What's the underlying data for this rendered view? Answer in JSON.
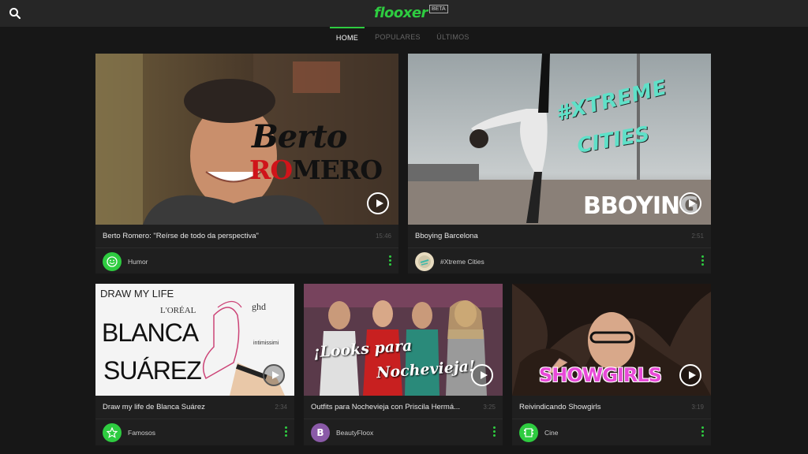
{
  "header": {
    "logo": "flooxer",
    "beta": "BETA",
    "search_icon": "search-icon"
  },
  "nav": {
    "tabs": [
      {
        "label": "HOME",
        "active": true
      },
      {
        "label": "POPULARES",
        "active": false
      },
      {
        "label": "ÚLTIMOS",
        "active": false
      }
    ]
  },
  "colors": {
    "accent": "#2ecc40",
    "background": "#171717",
    "topbar": "#262626"
  },
  "videos": [
    {
      "title": "Berto Romero: \"Reírse de todo da perspectiva\"",
      "duration": "15:46",
      "channel": "Humor",
      "overlay_top": "Berto",
      "overlay_red": "RO",
      "overlay_black": "MERO"
    },
    {
      "title": "Bboying Barcelona",
      "duration": "2:51",
      "channel": "#Xtreme Cities",
      "overlay_top": "#XTREME",
      "overlay_mid": "CITIES",
      "overlay_bottom": "BBOYING"
    },
    {
      "title": "Draw my life de Blanca Suárez",
      "duration": "2:34",
      "channel": "Famosos",
      "overlay_top": "DRAW MY LIFE",
      "overlay_brand1": "L'ORÉAL",
      "overlay_brand2": "ghd",
      "overlay_brand3": "intimissimi",
      "overlay_name1": "BLANCA",
      "overlay_name2": "SUÁREZ"
    },
    {
      "title": "Outfits para Nochevieja con Priscila Hermá...",
      "duration": "3:25",
      "channel": "BeautyFloox",
      "overlay_line1": "¡Looks para",
      "overlay_line2": "Nochevieja!"
    },
    {
      "title": "Reivindicando Showgirls",
      "duration": "3:19",
      "channel": "Cine",
      "overlay_text": "SHOWGIRLS"
    }
  ]
}
